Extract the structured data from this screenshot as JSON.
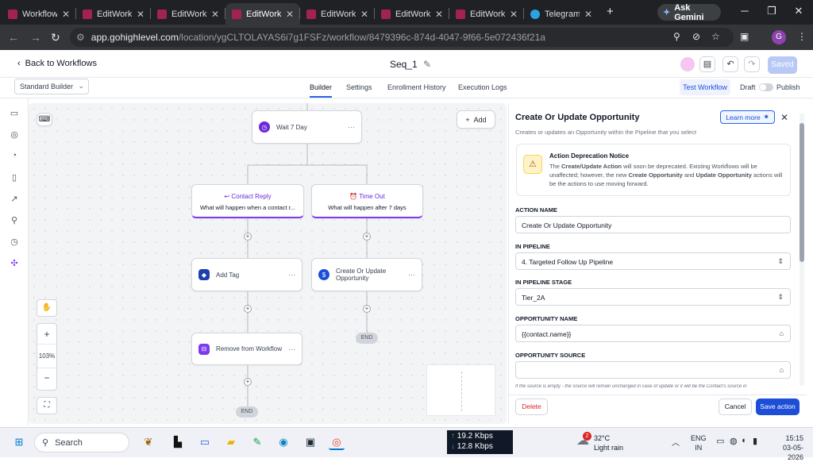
{
  "browser": {
    "tabs": [
      {
        "label": "Workflows",
        "active": false,
        "fav": "ghl"
      },
      {
        "label": "EditWorkfl",
        "active": false,
        "fav": "ghl"
      },
      {
        "label": "EditWorkfl",
        "active": false,
        "fav": "ghl"
      },
      {
        "label": "EditWorkfl",
        "active": true,
        "fav": "ghl"
      },
      {
        "label": "EditWorkfl",
        "active": false,
        "fav": "ghl"
      },
      {
        "label": "EditWorkfl",
        "active": false,
        "fav": "ghl"
      },
      {
        "label": "EditWorkfl",
        "active": false,
        "fav": "ghl"
      },
      {
        "label": "Telegram",
        "active": false,
        "fav": "telegram"
      }
    ],
    "new_tab": "+",
    "ask_gemini": "Ask Gemini",
    "url_host": "app.gohighlevel.com",
    "url_path": "/location/ygCLTOLAYAS6i7g1FSFz/workflow/8479396c-874d-4047-9f66-5e072436f21a",
    "profile_initial": "G"
  },
  "header": {
    "back_label": "Back to Workflows",
    "title": "Seq_1",
    "saved_label": "Saved"
  },
  "subheader": {
    "builder_select": "Standard Builder",
    "tabs": [
      "Builder",
      "Settings",
      "Enrollment History",
      "Execution Logs"
    ],
    "test_workflow": "Test Workflow",
    "draft": "Draft",
    "publish": "Publish"
  },
  "canvas": {
    "add_label": "Add",
    "wait_node": "Wait 7 Day",
    "branch_reply": {
      "title": "Contact Reply",
      "desc": "What will happen when a contact r..."
    },
    "branch_timeout": {
      "title": "Time Out",
      "desc": "What will happen after 7 days"
    },
    "add_tag": "Add Tag",
    "create_opp_1": "Create Or Update",
    "create_opp_2": "Opportunity",
    "remove_wf": "Remove from Workflow",
    "end": "END",
    "zoom": "103%"
  },
  "panel": {
    "title": "Create Or Update Opportunity",
    "learn_more": "Learn more",
    "subtitle": "Creates or updates an Opportunity within the Pipeline that you select",
    "notice_title": "Action Deprecation Notice",
    "notice_p1": "The ",
    "notice_b1": "Create/Update Action",
    "notice_p2": " will soon be deprecated. Existing Workflows will be unaffected; however, the new ",
    "notice_b2": "Create Opportunity",
    "notice_p3": " and ",
    "notice_b3": "Update Opportunity",
    "notice_p4": " actions will be the actions to use moving forward.",
    "action_name_label": "ACTION NAME",
    "action_name": "Create Or Update Opportunity",
    "pipeline_label": "IN PIPELINE",
    "pipeline": "4. Targeted Follow Up Pipeline",
    "stage_label": "IN PIPELINE STAGE",
    "stage": "Tier_2A",
    "opp_name_label": "OPPORTUNITY NAME",
    "opp_name": "{{contact.name}}",
    "opp_source_label": "OPPORTUNITY SOURCE",
    "opp_source": "",
    "hint": "If the source is empty - the source will remain unchanged in case of update or it will be the Contact's source in",
    "delete": "Delete",
    "cancel": "Cancel",
    "save": "Save action"
  },
  "taskbar": {
    "search": "Search",
    "net_up": "19.2 Kbps",
    "net_down": "12.8 Kbps",
    "weather_temp": "32°C",
    "weather_desc": "Light rain",
    "weather_badge": "2",
    "lang1": "ENG",
    "lang2": "IN",
    "time": "15:15",
    "date": "03-05-2026"
  }
}
